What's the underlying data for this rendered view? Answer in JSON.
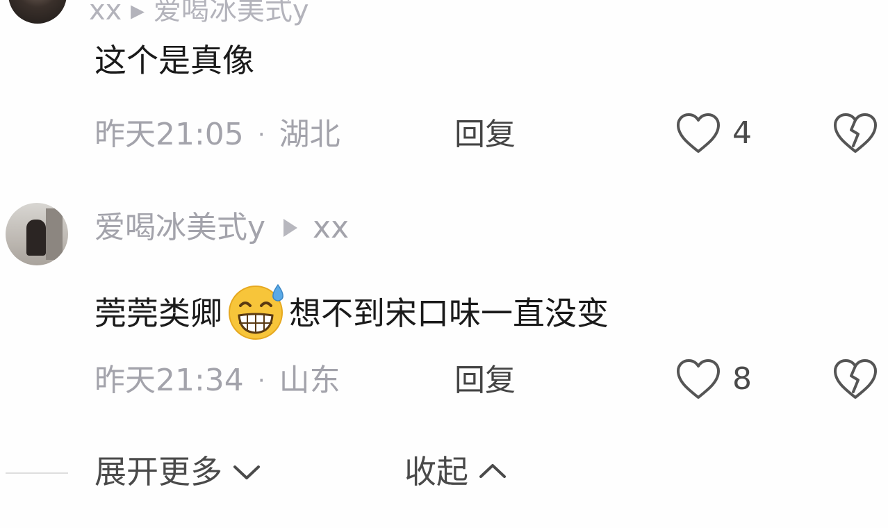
{
  "previous_comment": {
    "cut_header": "xx ▸ 爱喝冰美式y",
    "text": "这个是真像",
    "time": "昨天21:05",
    "location": "湖北",
    "reply_label": "回复",
    "likes": "4"
  },
  "comment": {
    "username": "爱喝冰美式y",
    "reply_to": "xx",
    "text_before_emoji": "莞莞类卿",
    "emoji": "grinning-sweat-emoji",
    "text_after_emoji": "想不到宋口味一直没变",
    "time": "昨天21:34",
    "location": "山东",
    "reply_label": "回复",
    "likes": "8"
  },
  "footer": {
    "expand_label": "展开更多",
    "collapse_label": "收起"
  },
  "icons": {
    "like": "heart-outline-icon",
    "dislike": "broken-heart-icon",
    "expand": "chevron-down-icon",
    "collapse": "chevron-up-icon",
    "reply_arrow": "triangle-right-icon"
  },
  "colors": {
    "primary_text": "#1a1a1a",
    "meta_text": "#a3a3ab",
    "action_text": "#444444",
    "icon_stroke": "#555555",
    "background": "#fefefe"
  }
}
